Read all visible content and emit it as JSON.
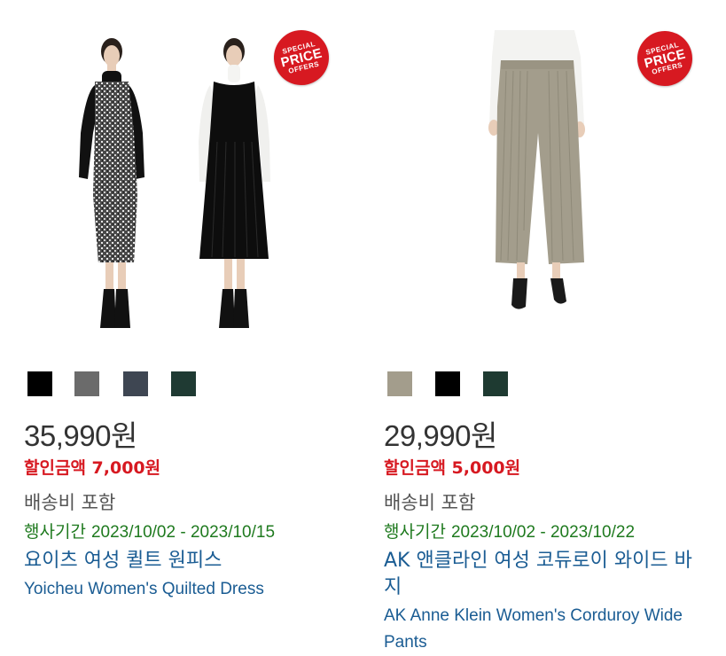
{
  "products": [
    {
      "badge": {
        "line1": "SPECIAL",
        "line2": "PRICE",
        "line3": "OFFERS"
      },
      "swatch_colors": [
        "#000000",
        "#6b6b6b",
        "#3e4652",
        "#1f3a33"
      ],
      "swatch_names": [
        "black",
        "grey-tweed",
        "navy-tweed",
        "dark-green"
      ],
      "price": "35,990",
      "currency": "원",
      "discount_label": "할인금액",
      "discount_amount": "7,000원",
      "shipping": "배송비 포함",
      "period_label": "행사기간",
      "period_dates": "2023/10/02 - 2023/10/15",
      "name_ko": "요이츠 여성 퀼트 원피스",
      "name_en": "Yoicheu Women's Quilted Dress"
    },
    {
      "badge": {
        "line1": "SPECIAL",
        "line2": "PRICE",
        "line3": "OFFERS"
      },
      "swatch_colors": [
        "#a39d8c",
        "#000000",
        "#1e3a31"
      ],
      "swatch_names": [
        "khaki",
        "black",
        "dark-green"
      ],
      "price": "29,990",
      "currency": "원",
      "discount_label": "할인금액",
      "discount_amount": "5,000원",
      "shipping": "배송비 포함",
      "period_label": "행사기간",
      "period_dates": "2023/10/02 - 2023/10/22",
      "name_ko": "AK 앤클라인 여성 코듀로이 와이드 바지",
      "name_en": "AK Anne Klein Women's Corduroy Wide Pants"
    }
  ]
}
